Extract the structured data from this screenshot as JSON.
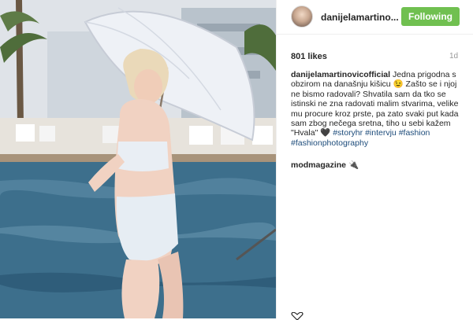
{
  "post": {
    "username": "danijelamartino...",
    "follow_label": "Following",
    "likes": "801 likes",
    "time": "1d",
    "caption": {
      "author": "danijelamartinovicofficial",
      "text_1": "Jedna prigodna s obzirom na današnju kišicu 😉 Zašto se i njoj ne bismo radovali? Shvatila sam da tko se istinski ne zna radovati malim stvarima, velike mu procure kroz prste, pa zato svaki put kada sam zbog nečega sretna, tiho u sebi kažem \"Hvala\" 🖤 ",
      "tags": [
        "#storyhr",
        "#intervju",
        "#fashion",
        "#fashionphotography"
      ]
    },
    "comment": {
      "author": "modmagazine",
      "text": "🔌"
    }
  },
  "colors": {
    "follow_button": "#70c050",
    "hashtag": "#1c4b7a"
  }
}
